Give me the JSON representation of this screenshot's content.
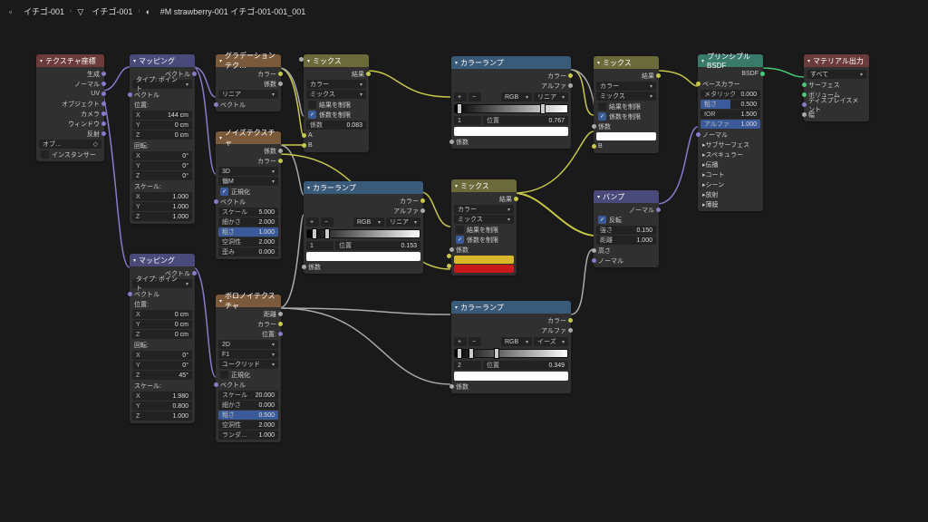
{
  "breadcrumb": {
    "a": "イチゴ-001",
    "b": "イチゴ-001",
    "c": "#M strawberry-001 イチゴ-001-001_001"
  },
  "labels": {
    "generate": "生成",
    "normal": "ノーマル",
    "uv": "UV",
    "object": "オブジェクト",
    "camera": "カメラ",
    "window": "ウィンドウ",
    "reflect": "反射",
    "instancer": "インスタンサー",
    "vector": "ベクトル",
    "type_point": "タイプ: ポイント",
    "loc": "位置:",
    "rot": "回転:",
    "scale": "スケール:",
    "color": "カラー",
    "fac": "係数",
    "alpha": "アルファ",
    "linear": "リニア",
    "ease": "イーズ",
    "result": "結果",
    "mix": "ミックス",
    "a": "A",
    "b": "B",
    "clamp_result": "結果を制限",
    "clamp_factor": "係数を制限",
    "roughness": "粗さ",
    "detail": "細かさ",
    "distortion": "空洞性",
    "scale_p": "スケール",
    "warp": "歪み",
    "metallic": "メタリック",
    "ior": "IOR",
    "transmission": "伝播",
    "subsurface": "サブサーフェス",
    "specular": "スペキュラー",
    "coat": "コート",
    "sheen": "シーン",
    "emission": "放射",
    "thin": "薄膜",
    "alpha_p": "アルファ",
    "base_color": "ベースカラー",
    "bsdf": "BSDF",
    "surface": "サーフェス",
    "volume": "ボリューム",
    "displacement": "ディスプレイスメント",
    "thick": "幅",
    "all": "すべて",
    "strength": "強さ",
    "distance": "距離",
    "invert": "反転",
    "height": "高さ",
    "rgb": "RGB",
    "pos": "位置",
    "f1": "F1",
    "euclid": "ユークリッド",
    "normalize": "正規化",
    "random": "ランダ…",
    "3d": "3D",
    "2d": "2D",
    "w": "偏M"
  },
  "nodes": {
    "texcoord": {
      "title": "テクスチャ座標",
      "obj_field": "オブ…"
    },
    "mapping1": {
      "title": "マッピング",
      "x": "X",
      "y": "Y",
      "z": "Z",
      "loc": [
        "144 cm",
        "0 cm",
        "0 cm"
      ],
      "rot": [
        "0°",
        "0°",
        "0°"
      ],
      "scale": [
        "1.000",
        "1.000",
        "1.000"
      ]
    },
    "mapping2": {
      "title": "マッピング",
      "loc": [
        "0 cm",
        "0 cm",
        "0 cm"
      ],
      "rot": [
        "0°",
        "0°",
        "45°"
      ],
      "scale": [
        "1.980",
        "0.800",
        "1.000"
      ]
    },
    "gradient": {
      "title": "グラデーションテク…"
    },
    "noise": {
      "title": "ノイズテクスチャ",
      "vals": {
        "scale": "5.000",
        "detail": "2.000",
        "rough": "1.000",
        "dist": "2.000",
        "warp": "0.000"
      }
    },
    "voronoi": {
      "title": "ボロノイテクスチャ",
      "vals": {
        "scale": "20.000",
        "detail": "0.000",
        "rough": "0.500",
        "dist": "2.000",
        "rand": "1.000"
      }
    },
    "ramp1": {
      "title": "カラーランプ",
      "idx": "1",
      "pos": "0.153"
    },
    "ramp2": {
      "title": "カラーランプ",
      "idx": "1",
      "pos": "0.767"
    },
    "ramp3": {
      "title": "カラーランプ",
      "idx": "2",
      "pos": "0.349"
    },
    "mix1": {
      "title": "ミックス",
      "fac": "0.083"
    },
    "mix2": {
      "title": "ミックス"
    },
    "mix3": {
      "title": "ミックス"
    },
    "bump": {
      "title": "バンプ",
      "strength": "0.150",
      "distance": "1.000"
    },
    "principled": {
      "title": "プリンシプルBSDF",
      "metallic": "0.000",
      "rough": "0.500",
      "ior": "1.500",
      "alpha": "1.000"
    },
    "output": {
      "title": "マテリアル出力"
    }
  }
}
